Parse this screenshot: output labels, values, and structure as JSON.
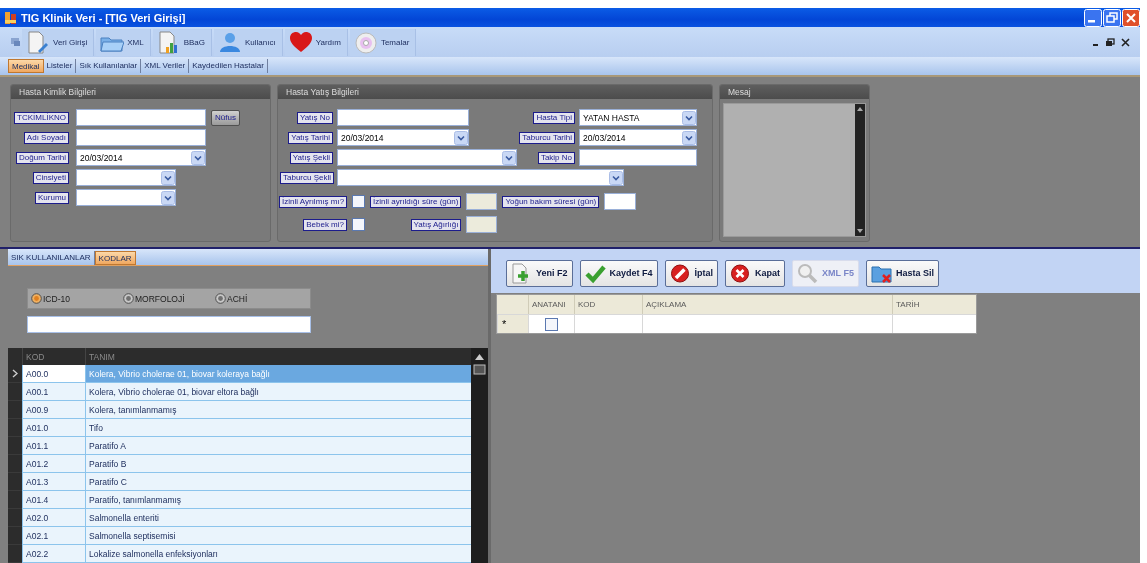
{
  "window": {
    "title": "TIG Klinik Veri - [TIG Veri Girişi]"
  },
  "toolbar": [
    {
      "label": "Veri Girişi",
      "kind": "document"
    },
    {
      "label": "XML",
      "kind": "folder"
    },
    {
      "label": "BBaG",
      "kind": "chart"
    },
    {
      "label": "Kullanıcı",
      "kind": "user"
    },
    {
      "label": "Yardım",
      "kind": "heart"
    },
    {
      "label": "Temalar",
      "kind": "disc"
    }
  ],
  "tabs": [
    {
      "label": "Medikal",
      "selected": true
    },
    {
      "label": "Listeler",
      "selected": false
    },
    {
      "label": "Sık Kullanılanlar",
      "selected": false
    },
    {
      "label": "XML Veriler",
      "selected": false
    },
    {
      "label": "Kaydedilen Hastalar",
      "selected": false
    }
  ],
  "kimlik": {
    "title": "Hasta Kimlik Bilgileri",
    "button": "Nüfus",
    "fields": [
      {
        "label": "TCKİMLİKNO",
        "kind": "text"
      },
      {
        "label": "Adı Soyadı",
        "kind": "text"
      },
      {
        "label": "Doğum Tarihi",
        "kind": "combo",
        "value": "20/03/2014"
      },
      {
        "label": "Cinsiyeti",
        "kind": "combo"
      },
      {
        "label": "Kurumu",
        "kind": "combo"
      }
    ]
  },
  "yatis": {
    "title": "Hasta Yatış Bilgileri",
    "fields": [
      {
        "label": "Yatış No",
        "kind": "text"
      },
      {
        "label": "Hasta Tipi",
        "kind": "combo",
        "value": "YATAN HASTA"
      },
      {
        "label": "Yatış Tarihi",
        "kind": "combo",
        "value": "20/03/2014"
      },
      {
        "label": "Taburcu Tarihi",
        "kind": "combo",
        "value": "20/03/2014"
      },
      {
        "label": "Yatış Şekli",
        "kind": "combo"
      },
      {
        "label": "Takip No",
        "kind": "text"
      },
      {
        "label": "Taburcu Şekli",
        "kind": "combo"
      }
    ],
    "checks": [
      {
        "label": "İzinli Ayrılmış mı?",
        "checked": false
      },
      {
        "label": "Bebek mi?",
        "checked": false
      }
    ],
    "small_fields": [
      {
        "label": "İzinli ayrıldığı süre (gün)",
        "disabled": true
      },
      {
        "label": "Yoğun bakım süresi (gün)",
        "disabled": false
      },
      {
        "label": "Yatış Ağırlığı",
        "disabled": true
      }
    ]
  },
  "mesaj": {
    "title": "Mesaj"
  },
  "codes": {
    "tabs": [
      {
        "label": "SIK KULLANILANLAR",
        "selected": false
      },
      {
        "label": "KODLAR",
        "selected": true
      }
    ],
    "radios": [
      {
        "label": "ICD-10",
        "selected": true
      },
      {
        "label": "MORFOLOJİ",
        "selected": false
      },
      {
        "label": "ACHİ",
        "selected": false
      }
    ],
    "columns": [
      "KOD",
      "TANIM"
    ],
    "rows": [
      {
        "code": "A00.0",
        "name": "Kolera, Vibrio cholerae 01, biovar koleraya bağlı",
        "selected": true
      },
      {
        "code": "A00.1",
        "name": "Kolera, Vibrio cholerae 01, biovar eltora bağlı",
        "selected": false
      },
      {
        "code": "A00.9",
        "name": "Kolera, tanımlanmamış",
        "selected": false
      },
      {
        "code": "A01.0",
        "name": "Tifo",
        "selected": false
      },
      {
        "code": "A01.1",
        "name": "Paratifo A",
        "selected": false
      },
      {
        "code": "A01.2",
        "name": "Paratifo B",
        "selected": false
      },
      {
        "code": "A01.3",
        "name": "Paratifo C",
        "selected": false
      },
      {
        "code": "A01.4",
        "name": "Paratifo, tanımlanmamış",
        "selected": false
      },
      {
        "code": "A02.0",
        "name": "Salmonella enteriti",
        "selected": false
      },
      {
        "code": "A02.1",
        "name": "Salmonella septisemisi",
        "selected": false
      },
      {
        "code": "A02.2",
        "name": "Lokalize salmonella enfeksiyonları",
        "selected": false
      }
    ]
  },
  "records": {
    "buttons": [
      {
        "label": "Yeni F2",
        "kind": "new",
        "disabled": false
      },
      {
        "label": "Kaydet F4",
        "kind": "save",
        "disabled": false
      },
      {
        "label": "İptal",
        "kind": "cancel",
        "disabled": false
      },
      {
        "label": "Kapat",
        "kind": "close",
        "disabled": false
      },
      {
        "label": "XML F5",
        "kind": "xml",
        "disabled": true
      },
      {
        "label": "Hasta Sil",
        "kind": "delete",
        "disabled": false
      }
    ],
    "columns": [
      "ANATANI",
      "KOD",
      "AÇIKLAMA",
      "TARİH"
    ],
    "new_row": {
      "marker": "*",
      "checked": false
    }
  }
}
